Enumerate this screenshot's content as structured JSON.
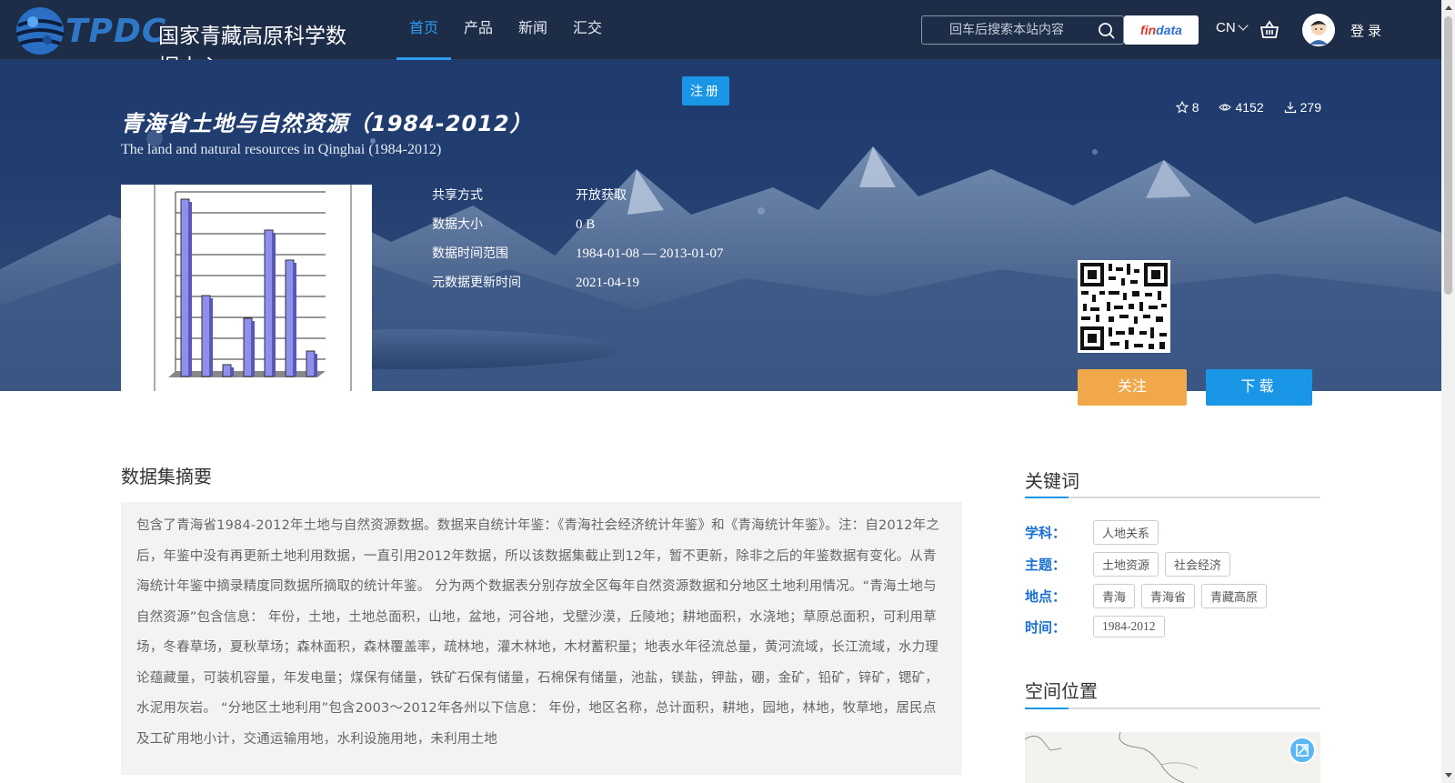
{
  "header": {
    "logo_text": "TPDC",
    "logo_name": "国家青藏高原科学数据中心",
    "nav": [
      {
        "label": "首页",
        "active": true
      },
      {
        "label": "产品",
        "active": false
      },
      {
        "label": "新闻",
        "active": false
      },
      {
        "label": "汇交",
        "active": false
      }
    ],
    "search_placeholder": "回车后搜索本站内容",
    "findata_a": "fin",
    "findata_b": "data",
    "lang": "CN",
    "login": "登录"
  },
  "hero": {
    "register": "注册",
    "title_cn": "青海省土地与自然资源（1984-2012）",
    "title_en": "The land and natural resources in Qinghai (1984-2012)",
    "stats": {
      "stars": "8",
      "views": "4152",
      "downloads": "279"
    },
    "meta": [
      {
        "label": "共享方式",
        "value": "开放获取"
      },
      {
        "label": "数据大小",
        "value": "0 B"
      },
      {
        "label": "数据时间范围",
        "value": "1984-01-08 — 2013-01-07"
      },
      {
        "label": "元数据更新时间",
        "value": "2021-04-19"
      }
    ],
    "follow": "关注",
    "download": "下载"
  },
  "abstract": {
    "title": "数据集摘要",
    "text": "包含了青海省1984-2012年土地与自然资源数据。数据来自统计年鉴：《青海社会经济统计年鉴》和《青海统计年鉴》。注：自2012年之后，年鉴中没有再更新土地利用数据，一直引用2012年数据，所以该数据集截止到12年，暂不更新，除非之后的年鉴数据有变化。从青海统计年鉴中摘录精度同数据所摘取的统计年鉴。 分为两个数据表分别存放全区每年自然资源数据和分地区土地利用情况。“青海土地与自然资源”包含信息： 年份，土地，土地总面积，山地，盆地，河谷地，戈壁沙漠，丘陵地；耕地面积，水浇地；草原总面积，可利用草场，冬春草场，夏秋草场；森林面积，森林覆盖率，疏林地，灌木林地，木材蓄积量；地表水年径流总量，黄河流域，长江流域，水力理论蕴藏量，可装机容量，年发电量；煤保有储量，铁矿石保有储量，石棉保有储量，池盐，镁盐，钾盐，硼，金矿，铅矿，锌矿，锶矿，水泥用灰岩。 “分地区土地利用”包含2003～2012年各州以下信息： 年份，地区名称，总计面积，耕地，园地，林地，牧草地，居民点及工矿用地小计，交通运输用地，水利设施用地，未利用土地"
  },
  "keywords": {
    "title": "关键词",
    "rows": [
      {
        "label": "学科：",
        "tags": [
          "人地关系"
        ]
      },
      {
        "label": "主题：",
        "tags": [
          "土地资源",
          "社会经济"
        ]
      },
      {
        "label": "地点：",
        "tags": [
          "青海",
          "青海省",
          "青藏高原"
        ]
      },
      {
        "label": "时间：",
        "tags": [
          "1984-2012"
        ]
      }
    ]
  },
  "spatial": {
    "title": "空间位置"
  },
  "colors": {
    "accent": "#1996e6",
    "nav_bg": "#1d2c47",
    "follow": "#f0a84a",
    "keyword_label": "#1a6fd1"
  }
}
